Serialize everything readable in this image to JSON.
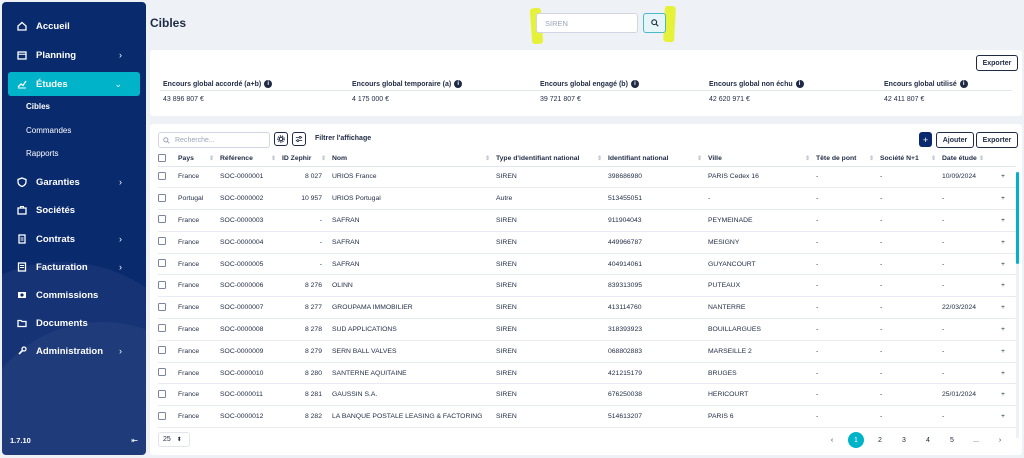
{
  "sidebar": {
    "items": [
      {
        "label": "Accueil",
        "icon": "home-icon",
        "has_children": false
      },
      {
        "label": "Planning",
        "icon": "calendar-icon",
        "has_children": true
      },
      {
        "label": "Études",
        "icon": "chart-icon",
        "has_children": true,
        "active": true
      },
      {
        "label": "Garanties",
        "icon": "shield-icon",
        "has_children": true
      },
      {
        "label": "Sociétés",
        "icon": "briefcase-icon",
        "has_children": false
      },
      {
        "label": "Contrats",
        "icon": "contract-icon",
        "has_children": true
      },
      {
        "label": "Facturation",
        "icon": "invoice-icon",
        "has_children": true
      },
      {
        "label": "Commissions",
        "icon": "commission-icon",
        "has_children": false
      },
      {
        "label": "Documents",
        "icon": "folder-icon",
        "has_children": false
      },
      {
        "label": "Administration",
        "icon": "wrench-icon",
        "has_children": true
      }
    ],
    "subitems": [
      {
        "label": "Cibles",
        "active": true
      },
      {
        "label": "Commandes",
        "active": false
      },
      {
        "label": "Rapports",
        "active": false
      }
    ],
    "version": "1.7.10",
    "accent_color": "#00b3c8",
    "background_color": "#0a2a6e"
  },
  "header": {
    "title": "Cibles",
    "search_placeholder": "SIREN"
  },
  "summary": {
    "export_label": "Exporter",
    "metrics": [
      {
        "label": "Encours global accordé (a+b)",
        "value": "43 896 807 €"
      },
      {
        "label": "Encours global temporaire (a)",
        "value": "4 175 000 €"
      },
      {
        "label": "Encours global engagé (b)",
        "value": "39 721 807 €"
      },
      {
        "label": "Encours global non échu",
        "value": "42 620 971 €"
      },
      {
        "label": "Encours global utilisé",
        "value": "42 411 807 €"
      }
    ]
  },
  "table": {
    "search_placeholder": "Recherche...",
    "filter_label": "Filtrer l'affichage",
    "add_label": "Ajouter",
    "export_label": "Exporter",
    "columns": [
      "Pays",
      "Référence",
      "ID Zephir",
      "Nom",
      "Type d'identifiant national",
      "Identifiant national",
      "Ville",
      "Tête de pont",
      "Société N+1",
      "Date étude"
    ],
    "rows": [
      [
        "France",
        "SOC-0000001",
        "8 027",
        "URIOS France",
        "SIREN",
        "398686980",
        "PARIS Cedex 16",
        "-",
        "-",
        "10/09/2024"
      ],
      [
        "Portugal",
        "SOC-0000002",
        "10 957",
        "URIOS Portugal",
        "Autre",
        "513455051",
        "-",
        "-",
        "-",
        "-"
      ],
      [
        "France",
        "SOC-0000003",
        "-",
        "SAFRAN",
        "SIREN",
        "911904043",
        "PEYMEINADE",
        "-",
        "-",
        "-"
      ],
      [
        "France",
        "SOC-0000004",
        "-",
        "SAFRAN",
        "SIREN",
        "449966787",
        "MESIGNY",
        "-",
        "-",
        "-"
      ],
      [
        "France",
        "SOC-0000005",
        "-",
        "SAFRAN",
        "SIREN",
        "404914061",
        "GUYANCOURT",
        "-",
        "-",
        "-"
      ],
      [
        "France",
        "SOC-0000006",
        "8 276",
        "OLINN",
        "SIREN",
        "839313095",
        "PUTEAUX",
        "-",
        "-",
        "-"
      ],
      [
        "France",
        "SOC-0000007",
        "8 277",
        "GROUPAMA IMMOBILIER",
        "SIREN",
        "413114760",
        "NANTERRE",
        "-",
        "-",
        "22/03/2024"
      ],
      [
        "France",
        "SOC-0000008",
        "8 278",
        "SUD APPLICATIONS",
        "SIREN",
        "318393923",
        "BOUILLARGUES",
        "-",
        "-",
        "-"
      ],
      [
        "France",
        "SOC-0000009",
        "8 279",
        "SERN BALL VALVES",
        "SIREN",
        "068802883",
        "MARSEILLE 2",
        "-",
        "-",
        "-"
      ],
      [
        "France",
        "SOC-0000010",
        "8 280",
        "SANTERNE AQUITAINE",
        "SIREN",
        "421215179",
        "BRUGES",
        "-",
        "-",
        "-"
      ],
      [
        "France",
        "SOC-0000011",
        "8 281",
        "GAUSSIN S.A.",
        "SIREN",
        "676250038",
        "HERICOURT",
        "-",
        "-",
        "25/01/2024"
      ],
      [
        "France",
        "SOC-0000012",
        "8 282",
        "LA BANQUE POSTALE LEASING & FACTORING",
        "SIREN",
        "514613207",
        "PARIS 6",
        "-",
        "-",
        "-"
      ]
    ],
    "page_size": "25",
    "pagination": {
      "prev": "‹",
      "pages": [
        "1",
        "2",
        "3",
        "4",
        "5"
      ],
      "current": "1",
      "ellipsis": "...",
      "next": "›"
    }
  }
}
